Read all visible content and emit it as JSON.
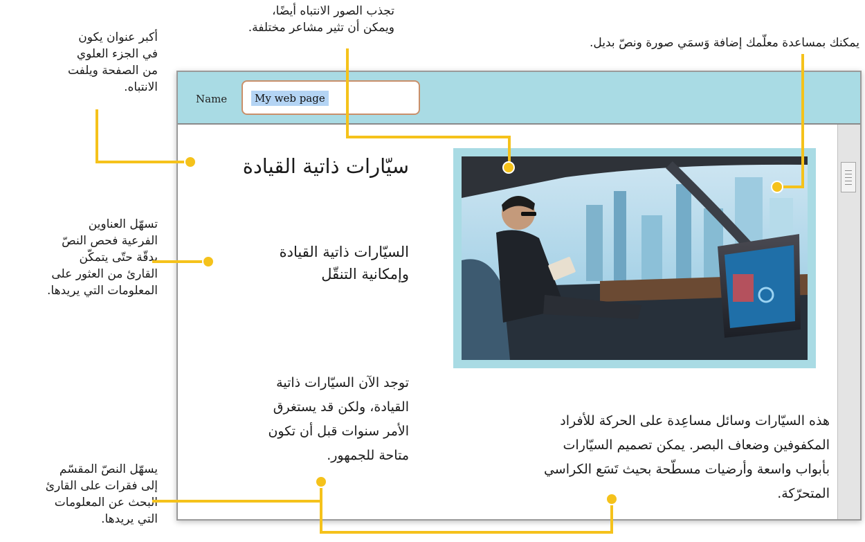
{
  "annotations": {
    "heading_note": [
      "أكبر عنوان يكون",
      "في الجزء العلوي",
      "من الصفحة ويلفت",
      "الانتباه."
    ],
    "subheading_note": [
      "تسهّل العناوين",
      "الفرعية فحص النصّ",
      "بدقّة حتّى يتمكّن",
      "القارئ من العثور على",
      "المعلومات التي يريدها."
    ],
    "paragraph_note": [
      "يسهّل النصّ المقسّم",
      "إلى فقرات على القارئ",
      "البحث عن المعلومات",
      "التي يريدها."
    ],
    "image_note": [
      "تجذب الصور الانتباه أيضًا،",
      "ويمكن أن تثير مشاعر مختلفة."
    ],
    "alt_text_note": "يمكنك بمساعدة معلّمك إضافة وَسمَي صورة ونصّ بديل."
  },
  "window": {
    "name_label": "Name",
    "name_value": "My web page",
    "heading": "سيّارات ذاتية القيادة",
    "subheading": [
      "السيّارات ذاتية القيادة",
      "وإمكانية التنقّل"
    ],
    "paragraph1": [
      "توجد الآن السيّارات ذاتية",
      "القيادة، ولكن قد يستغرق",
      "الأمر سنوات قبل أن تكون",
      "متاحة للجمهور."
    ],
    "paragraph2": [
      "هذه السيّارات وسائل مساعِدة على الحركة للأفراد",
      "المكفوفين وضعاف البصر. يمكن تصميم السيّارات",
      "بأبواب واسعة وأرضيات مسطّحة بحيث تَسَع الكراسي",
      "المتحرّكة."
    ]
  },
  "colors": {
    "accent_yellow": "#f5c21b",
    "header_blue": "#a9dbe4",
    "input_border": "#c98f6a",
    "selection": "#b4d4f4"
  }
}
